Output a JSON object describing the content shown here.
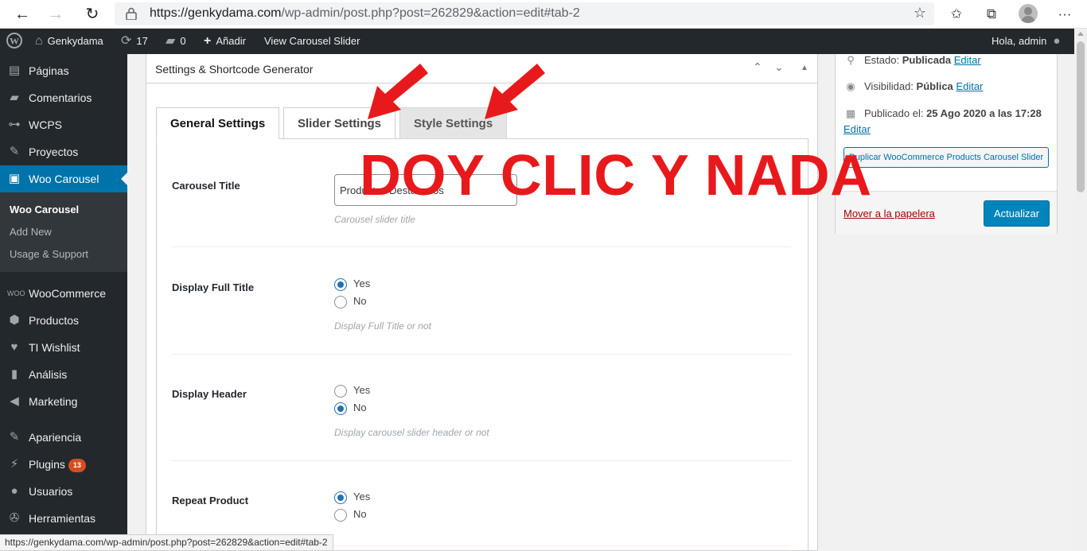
{
  "browser": {
    "url_host": "https://genkydama.com",
    "url_path": "/wp-admin/post.php?post=262829&action=edit#tab-2"
  },
  "adminbar": {
    "site_name": "Genkydama",
    "updates_count": "17",
    "comments_count": "0",
    "add_label": "Añadir",
    "view_label": "View Carousel Slider",
    "greeting": "Hola, admin"
  },
  "sidebar": {
    "items": [
      {
        "label": "Páginas",
        "icon": "pages-icon"
      },
      {
        "label": "Comentarios",
        "icon": "comments-icon"
      },
      {
        "label": "WCPS",
        "icon": "wcps-icon"
      },
      {
        "label": "Proyectos",
        "icon": "pin-icon"
      },
      {
        "label": "Woo Carousel",
        "icon": "carousel-icon"
      },
      {
        "label": "WooCommerce",
        "icon": "woocommerce-icon"
      },
      {
        "label": "Productos",
        "icon": "products-icon"
      },
      {
        "label": "TI Wishlist",
        "icon": "heart-icon"
      },
      {
        "label": "Análisis",
        "icon": "chart-icon"
      },
      {
        "label": "Marketing",
        "icon": "megaphone-icon"
      },
      {
        "label": "Apariencia",
        "icon": "brush-icon"
      },
      {
        "label": "Plugins",
        "icon": "plug-icon",
        "badge": "13"
      },
      {
        "label": "Usuarios",
        "icon": "user-icon"
      },
      {
        "label": "Herramientas",
        "icon": "wrench-icon"
      }
    ],
    "submenu": [
      "Woo Carousel",
      "Add New",
      "Usage & Support"
    ]
  },
  "metabox": {
    "title": "Settings & Shortcode Generator",
    "tabs": [
      "General Settings",
      "Slider Settings",
      "Style Settings"
    ],
    "fields": {
      "carousel_title": {
        "label": "Carousel Title",
        "value": "Productos Destacados",
        "desc": "Carousel slider title"
      },
      "display_full_title": {
        "label": "Display Full Title",
        "options": [
          "Yes",
          "No"
        ],
        "selected": "Yes",
        "desc": "Display Full Title or not"
      },
      "display_header": {
        "label": "Display Header",
        "options": [
          "Yes",
          "No"
        ],
        "selected": "No",
        "desc": "Display carousel slider header or not"
      },
      "repeat_product": {
        "label": "Repeat Product",
        "options": [
          "Yes",
          "No"
        ],
        "selected": "Yes"
      }
    }
  },
  "publish": {
    "status_label": "Estado:",
    "status_value": "Publicada",
    "visibility_label": "Visibilidad:",
    "visibility_value": "Pública",
    "published_label": "Publicado el:",
    "published_value": "25 Ago 2020 a las 17:28",
    "edit_link": "Editar",
    "duplicate_button": "Duplicar WooCommerce Products Carousel Slider",
    "trash_link": "Mover a la papelera",
    "update_button": "Actualizar"
  },
  "annotation": {
    "text": "DOY CLIC Y NADA",
    "color": "#e8191c"
  },
  "statusbar": {
    "text": "https://genkydama.com/wp-admin/post.php?post=262829&action=edit#tab-2"
  }
}
